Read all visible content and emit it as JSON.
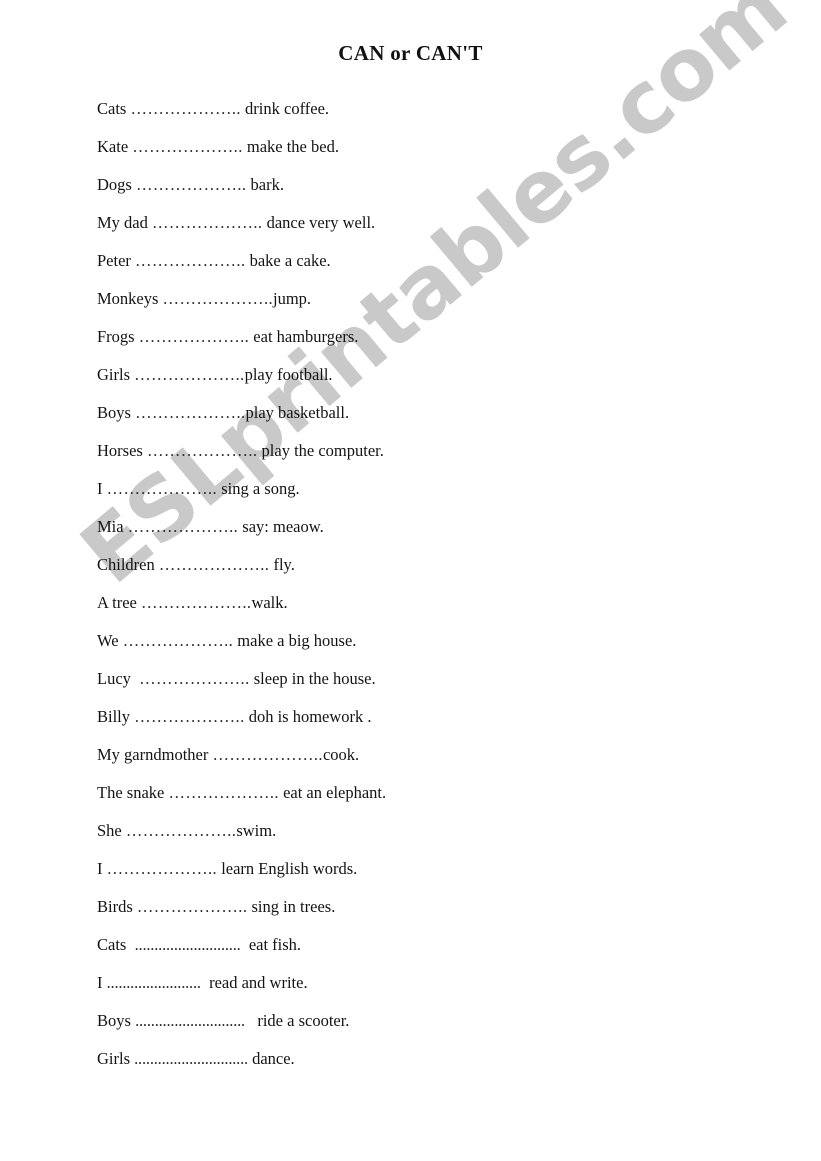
{
  "document": {
    "title": "CAN or CAN'T",
    "watermark": "ESLprintables.com",
    "watermark_color": "#c9c9c9",
    "page_background": "#ffffff",
    "text_color": "#141414"
  },
  "exercises": [
    {
      "subject": "Cats ",
      "blank": "………………..",
      "predicate": " drink coffee.",
      "dense": false
    },
    {
      "subject": "Kate ",
      "blank": "………………..",
      "predicate": " make the bed.",
      "dense": false
    },
    {
      "subject": "Dogs ",
      "blank": "………………..",
      "predicate": " bark.",
      "dense": false
    },
    {
      "subject": "My dad ",
      "blank": "………………..",
      "predicate": " dance very well.",
      "dense": false
    },
    {
      "subject": "Peter ",
      "blank": "………………..",
      "predicate": " bake a cake.",
      "dense": false
    },
    {
      "subject": "Monkeys ",
      "blank": "………………..",
      "predicate": "jump.",
      "dense": false
    },
    {
      "subject": "Frogs ",
      "blank": "………………..",
      "predicate": " eat hamburgers.",
      "dense": false
    },
    {
      "subject": "Girls ",
      "blank": "………………..",
      "predicate": "play football.",
      "dense": false
    },
    {
      "subject": "Boys ",
      "blank": "………………..",
      "predicate": "play basketball.",
      "dense": false
    },
    {
      "subject": "Horses ",
      "blank": "………………..",
      "predicate": " play the computer.",
      "dense": false
    },
    {
      "subject": "I ",
      "blank": "………………..",
      "predicate": " sing a song.",
      "dense": false
    },
    {
      "subject": "Mia ",
      "blank": "………………..",
      "predicate": " say: meaow.",
      "dense": false
    },
    {
      "subject": "Children ",
      "blank": "………………..",
      "predicate": " fly.",
      "dense": false
    },
    {
      "subject": "A tree ",
      "blank": "………………..",
      "predicate": "walk.",
      "dense": false
    },
    {
      "subject": "We ",
      "blank": "………………..",
      "predicate": " make a big house.",
      "dense": false
    },
    {
      "subject": "Lucy  ",
      "blank": "………………..",
      "predicate": " sleep in the house.",
      "dense": false
    },
    {
      "subject": "Billy ",
      "blank": "………………..",
      "predicate": " doh is homework .",
      "dense": false
    },
    {
      "subject": "My garndmother ",
      "blank": "………………..",
      "predicate": "cook.",
      "dense": false
    },
    {
      "subject": "The snake ",
      "blank": "………………..",
      "predicate": " eat an elephant.",
      "dense": false
    },
    {
      "subject": "She ",
      "blank": "………………..",
      "predicate": "swim.",
      "dense": false
    },
    {
      "subject": "I ",
      "blank": "………………..",
      "predicate": " learn English words.",
      "dense": false
    },
    {
      "subject": "Birds ",
      "blank": "………………..",
      "predicate": " sing in trees.",
      "dense": false
    },
    {
      "subject": "Cats  ",
      "blank": "...........................",
      "predicate": "  eat fish.",
      "dense": true
    },
    {
      "subject": "I ",
      "blank": "........................",
      "predicate": "  read and write.",
      "dense": true
    },
    {
      "subject": "Boys ",
      "blank": "............................",
      "predicate": "   ride a scooter.",
      "dense": true
    },
    {
      "subject": "Girls ",
      "blank": ".............................",
      "predicate": " dance.",
      "dense": true
    }
  ]
}
